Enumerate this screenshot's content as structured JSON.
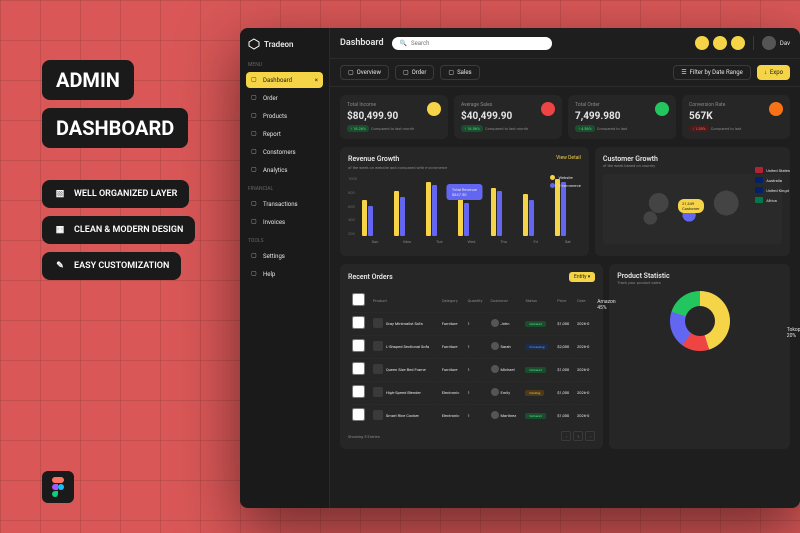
{
  "promo": {
    "title1": "ADMIN",
    "title2": "DASHBOARD"
  },
  "features": [
    "WELL ORGANIZED LAYER",
    "CLEAN & MODERN DESIGN",
    "EASY CUSTOMIZATION"
  ],
  "app_name": "Tradeon",
  "page_title": "Dashboard",
  "search": {
    "placeholder": "Search"
  },
  "user_name": "Dav",
  "sidebar": {
    "sections": [
      {
        "label": "MENU",
        "items": [
          "Dashboard",
          "Order",
          "Products",
          "Report",
          "Constomers",
          "Analytics"
        ]
      },
      {
        "label": "FINANCIAL",
        "items": [
          "Transactions",
          "Invoices"
        ]
      },
      {
        "label": "TOOLS",
        "items": [
          "Settings",
          "Help"
        ]
      }
    ]
  },
  "tabs": [
    "Overview",
    "Order",
    "Sales"
  ],
  "filter_label": "Filter by Date Range",
  "export_label": "Expo",
  "stats": [
    {
      "label": "Total Income",
      "value": "$80,499.90",
      "change": "18.26%",
      "dir": "up",
      "compare": "Compared to last month",
      "icon": "yellow"
    },
    {
      "label": "Average Sales",
      "value": "$40,499.90",
      "change": "18.56%",
      "dir": "up",
      "compare": "Compared to last month",
      "icon": "red"
    },
    {
      "label": "Total Order",
      "value": "7,499.980",
      "change": "4.56%",
      "dir": "up",
      "compare": "Compared to last",
      "icon": "green"
    },
    {
      "label": "Conversion Rate",
      "value": "567K",
      "change": "1.28%",
      "dir": "down",
      "compare": "Compared to last",
      "icon": "orange"
    }
  ],
  "revenue": {
    "title": "Revenue Growth",
    "sub": "of the week on website and compared with e-commerce",
    "link": "View Detail",
    "tooltip_label": "Total Revenue",
    "tooltip_value": "$847.50",
    "legend": [
      "Website",
      "E-commerce"
    ]
  },
  "customer": {
    "title": "Customer Growth",
    "sub": "of the week based on country",
    "badge_value": "21,349",
    "badge_label": "Customer",
    "countries": [
      "United States",
      "Australia",
      "United Kingd",
      "Africa"
    ]
  },
  "orders": {
    "title": "Recent Orders",
    "entity": "Entity",
    "columns": [
      "Product",
      "Category",
      "Quantity",
      "Customer",
      "Status",
      "Price",
      "Orde"
    ],
    "rows": [
      {
        "product": "Gray Minimalist Sofa",
        "cat": "Furniture",
        "qty": "1",
        "cust": "John",
        "status": "delivered",
        "price": "$1,000",
        "date": "2026-0"
      },
      {
        "product": "L-Shaped Sectional Sofa",
        "cat": "Furniture",
        "qty": "1",
        "cust": "Sarah",
        "status": "processing",
        "price": "$2,000",
        "date": "2026-0"
      },
      {
        "product": "Queen Size Bed Frame",
        "cat": "Furniture",
        "qty": "1",
        "cust": "Michael",
        "status": "delivered",
        "price": "$1,000",
        "date": "2026-0"
      },
      {
        "product": "High-Speed Blender",
        "cat": "Electronic",
        "qty": "1",
        "cust": "Emily",
        "status": "pending",
        "price": "$1,000",
        "date": "2026-0"
      },
      {
        "product": "Smart Rice Cooker",
        "cat": "Electronic",
        "qty": "1",
        "cust": "Martinez",
        "status": "delivered",
        "price": "$1,000",
        "date": "2026-0"
      }
    ],
    "showing": "Showing 5 Entries",
    "page": "1"
  },
  "product_stat": {
    "title": "Product Statistic",
    "sub": "Track your product sales",
    "label1": "Amazon",
    "label1_val": "45%",
    "label2": "Tokopedia",
    "label2_val": "20%"
  },
  "chart_data": {
    "type": "bar",
    "title": "Revenue Growth",
    "categories": [
      "Sun",
      "Mon",
      "Tue",
      "Wed",
      "Thu",
      "Fri",
      "Sat"
    ],
    "series": [
      {
        "name": "Website",
        "values": [
          600,
          750,
          900,
          650,
          800,
          700,
          950
        ]
      },
      {
        "name": "E-commerce",
        "values": [
          500,
          650,
          850,
          550,
          750,
          600,
          900
        ]
      }
    ],
    "ylabel": "",
    "ylim": [
      0,
      1000
    ],
    "y_ticks": [
      "1000",
      "800",
      "600",
      "400",
      "200"
    ]
  }
}
